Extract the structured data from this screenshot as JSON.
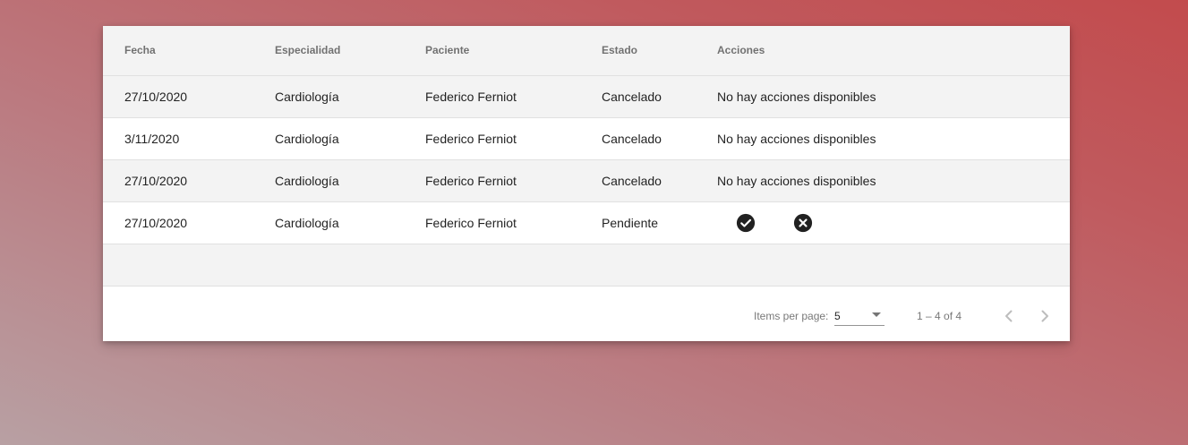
{
  "table": {
    "headers": {
      "fecha": "Fecha",
      "especialidad": "Especialidad",
      "paciente": "Paciente",
      "estado": "Estado",
      "acciones": "Acciones"
    },
    "rows": [
      {
        "fecha": "27/10/2020",
        "especialidad": "Cardiología",
        "paciente": "Federico Ferniot",
        "estado": "Cancelado",
        "acciones": "No hay acciones disponibles"
      },
      {
        "fecha": "3/11/2020",
        "especialidad": "Cardiología",
        "paciente": "Federico Ferniot",
        "estado": "Cancelado",
        "acciones": "No hay acciones disponibles"
      },
      {
        "fecha": "27/10/2020",
        "especialidad": "Cardiología",
        "paciente": "Federico Ferniot",
        "estado": "Cancelado",
        "acciones": "No hay acciones disponibles"
      },
      {
        "fecha": "27/10/2020",
        "especialidad": "Cardiología",
        "paciente": "Federico Ferniot",
        "estado": "Pendiente",
        "acciones_icons": [
          "check-circle-icon",
          "cancel-circle-icon"
        ]
      }
    ]
  },
  "paginator": {
    "items_per_page_label": "Items per page:",
    "items_per_page_value": "5",
    "range_label": "1 – 4 of 4",
    "prev_icon": "chevron-left-icon",
    "next_icon": "chevron-right-icon"
  },
  "colors": {
    "header_bg": "#f3f3f3",
    "row_alt_bg": "#f3f3f3",
    "icon_dark": "#212121",
    "background_gradient_start": "#b8a0a3",
    "background_gradient_end": "#c24b4d"
  }
}
